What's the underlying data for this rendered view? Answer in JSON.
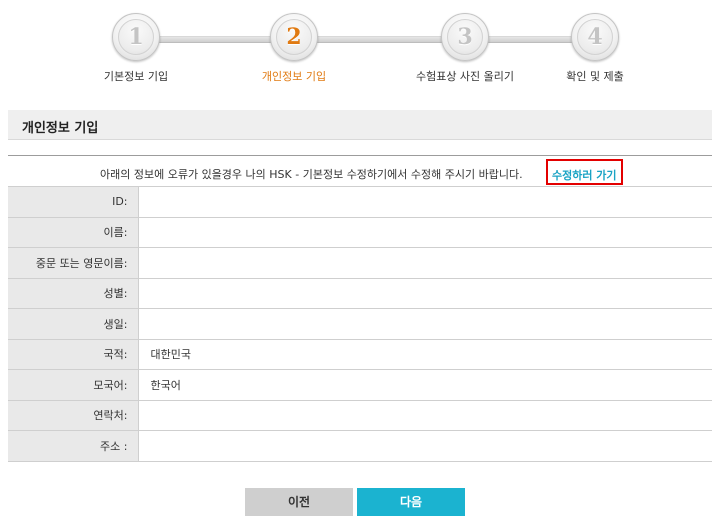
{
  "steps": [
    {
      "number": "1",
      "label": "기본정보 기입"
    },
    {
      "number": "2",
      "label": "개인정보 기입"
    },
    {
      "number": "3",
      "label": "수험표상 사진 올리기"
    },
    {
      "number": "4",
      "label": "확인 및 제출"
    }
  ],
  "active_step": 2,
  "section": {
    "title": "개인정보 기입"
  },
  "notice": {
    "message": "아래의 정보에 오류가 있을경우 나의 HSK - 기본정보 수정하기에서 수정해 주시기 바랍니다.",
    "link_label": "수정하러 가기"
  },
  "fields": [
    {
      "label": "ID:",
      "value": ""
    },
    {
      "label": "이름:",
      "value": ""
    },
    {
      "label": "중문 또는 영문이름:",
      "value": ""
    },
    {
      "label": "성별:",
      "value": ""
    },
    {
      "label": "생일:",
      "value": ""
    },
    {
      "label": "국적:",
      "value": "대한민국"
    },
    {
      "label": "모국어:",
      "value": "한국어"
    },
    {
      "label": "연락처:",
      "value": ""
    },
    {
      "label": "주소 :",
      "value": ""
    }
  ],
  "buttons": {
    "prev": "이전",
    "next": "다음"
  },
  "colors": {
    "accent": "#e07a12",
    "next_button": "#1bb3d0",
    "link": "#1aa3c4",
    "highlight_border": "#e30000"
  }
}
